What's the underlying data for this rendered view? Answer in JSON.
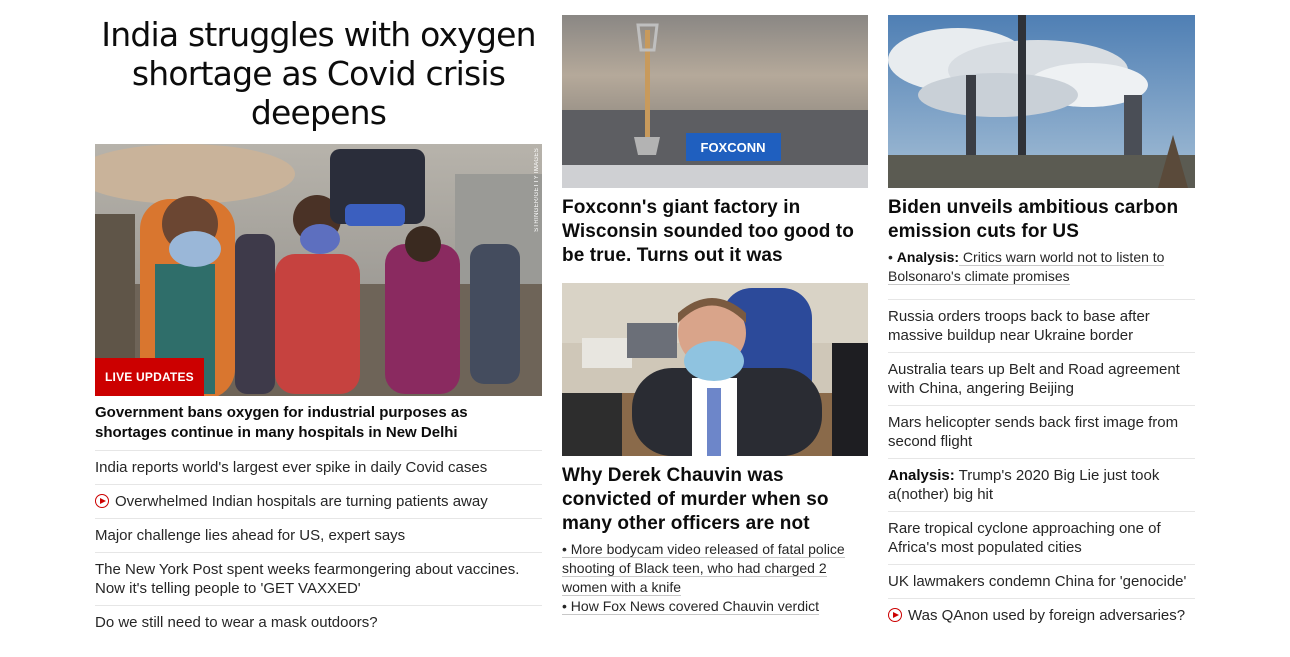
{
  "left": {
    "headline": "India struggles with oxygen shortage as Covid crisis deepens",
    "badge": "LIVE UPDATES",
    "photo_credit": "STRINGER/GETTY IMAGES",
    "lead_sub": "Government bans oxygen for industrial purposes as shortages continue in many hospitals in New Delhi",
    "items": [
      {
        "text": "India reports world's largest ever spike in daily Covid cases",
        "video": false
      },
      {
        "text": "Overwhelmed Indian hospitals are turning patients away",
        "video": true
      },
      {
        "text": "Major challenge lies ahead for US, expert says",
        "video": false
      },
      {
        "text": "The New York Post spent weeks fearmongering about vaccines. Now it's telling people to 'GET VAXXED'",
        "video": false
      },
      {
        "text": "Do we still need to wear a mask outdoors?",
        "video": false
      }
    ]
  },
  "middle": {
    "card1": {
      "image_text": "FOXCONN",
      "headline": "Foxconn's giant factory in Wisconsin sounded too good to be true. Turns out it was"
    },
    "card2": {
      "headline": "Why Derek Chauvin was convicted of murder when so many other officers are not",
      "bullets": [
        "• More bodycam video released of fatal police shooting of Black teen, who had charged 2 women with a knife",
        "• How Fox News covered Chauvin verdict"
      ]
    }
  },
  "right": {
    "card": {
      "headline": "Biden unveils ambitious carbon emission cuts for US",
      "bullet_prefix": "• ",
      "bullet_strong": "Analysis:",
      "bullet_text": " Critics warn world not to listen to Bolsonaro's climate promises"
    },
    "items": [
      {
        "text": "Russia orders troops back to base after massive buildup near Ukraine border"
      },
      {
        "text": "Australia tears up Belt and Road agreement with China, angering Beijing"
      },
      {
        "text": "Mars helicopter sends back first image from second flight"
      },
      {
        "strong": "Analysis:",
        "text": " Trump's 2020 Big Lie just took a(nother) big hit"
      },
      {
        "text": "Rare tropical cyclone approaching one of Africa's most populated cities"
      },
      {
        "text": "UK lawmakers condemn China for 'genocide'"
      },
      {
        "text": "Was QAnon used by foreign adversaries?",
        "video": true
      }
    ]
  },
  "colors": {
    "accent": "#cc0000",
    "text": "#0c0c0c",
    "divider": "#e6e6e6"
  }
}
